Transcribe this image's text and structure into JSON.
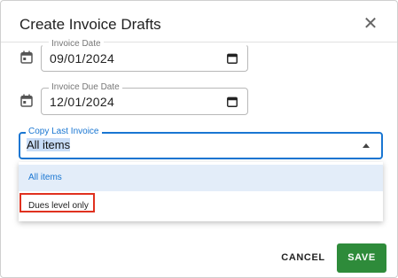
{
  "dialog": {
    "title": "Create Invoice Drafts",
    "close_glyph": "✕"
  },
  "fields": {
    "invoice_date": {
      "label": "Invoice Date",
      "value": "09/01/2024"
    },
    "invoice_due_date": {
      "label": "Invoice Due Date",
      "value": "12/01/2024"
    }
  },
  "copy_select": {
    "label": "Copy Last Invoice",
    "value": "All items",
    "options": [
      "All items",
      "Dues level only"
    ],
    "selected_index": 0,
    "highlighted_index": 1
  },
  "actions": {
    "cancel": "CANCEL",
    "save": "SAVE"
  },
  "colors": {
    "accent": "#1976d2",
    "save": "#2e8b3a",
    "highlight_border": "#e0311f"
  }
}
